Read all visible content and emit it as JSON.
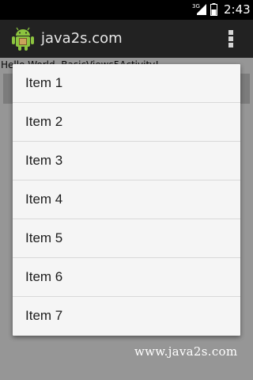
{
  "status_bar": {
    "network": "3G",
    "time": "2:43",
    "signal_icon": "signal-bars-icon",
    "battery_icon": "battery-icon"
  },
  "action_bar": {
    "title": "java2s.com",
    "app_icon": "android-robot-icon",
    "overflow_icon": "overflow-menu-icon"
  },
  "content": {
    "hello_text": "Hello World, BasicViews5Activity!"
  },
  "popup_menu": {
    "items": [
      {
        "label": "Item 1"
      },
      {
        "label": "Item 2"
      },
      {
        "label": "Item 3"
      },
      {
        "label": "Item 4"
      },
      {
        "label": "Item 5"
      },
      {
        "label": "Item 6"
      },
      {
        "label": "Item 7"
      }
    ]
  },
  "watermark": "www.java2s.com",
  "colors": {
    "status_bar": "#000000",
    "action_bar": "#222222",
    "menu_background": "#f5f5f5",
    "divider": "#d8d8d8"
  }
}
